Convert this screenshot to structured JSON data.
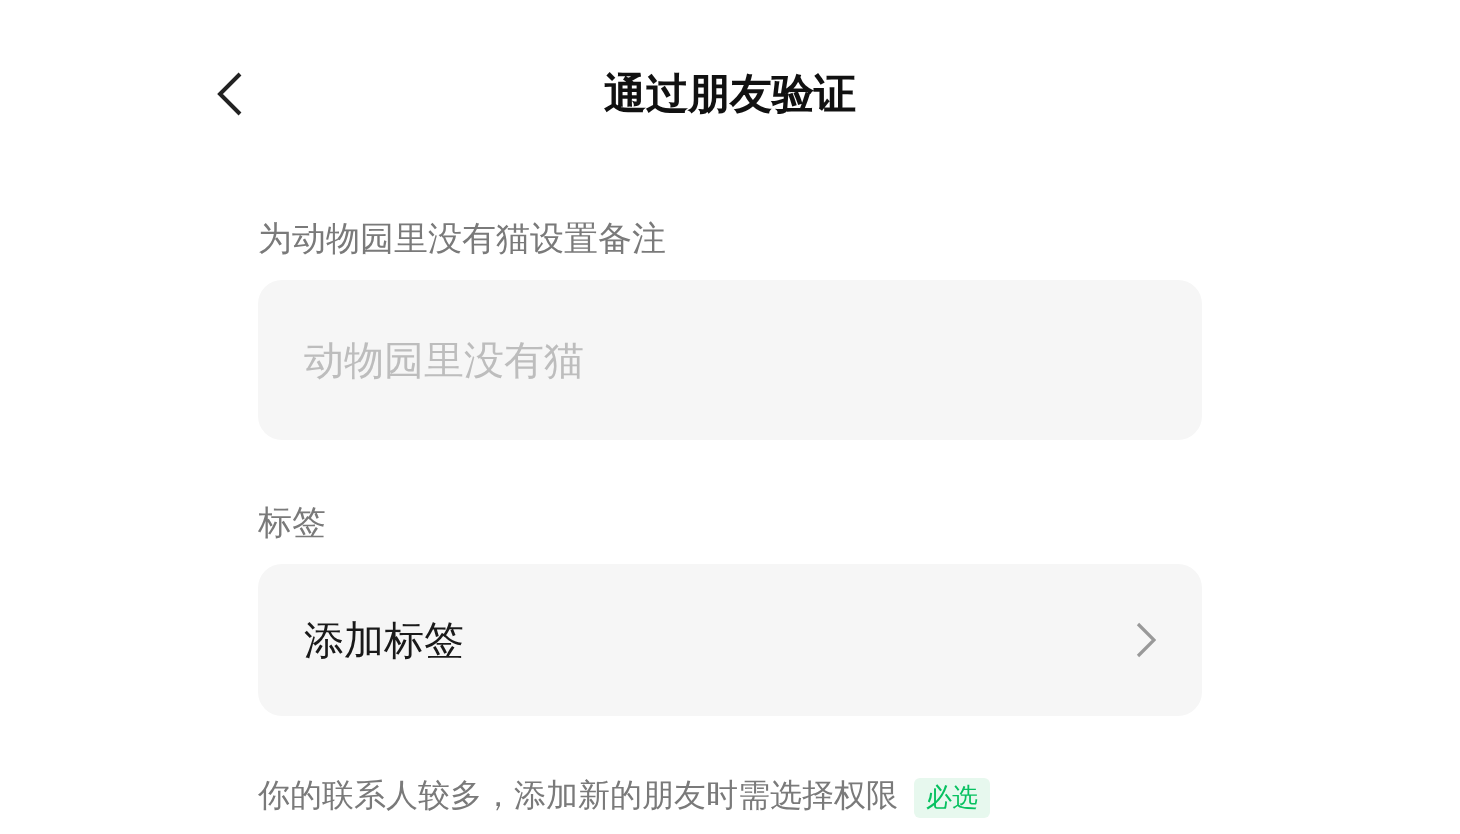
{
  "header": {
    "title": "通过朋友验证"
  },
  "remark": {
    "label": "为动物园里没有猫设置备注",
    "placeholder": "动物园里没有猫"
  },
  "tags": {
    "label": "标签",
    "row_label": "添加标签"
  },
  "notice": {
    "text": "你的联系人较多，添加新的朋友时需选择权限",
    "tag": "必选"
  }
}
